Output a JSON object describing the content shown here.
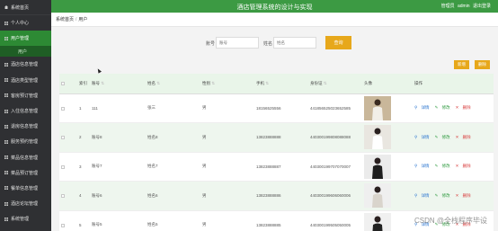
{
  "header": {
    "title": "酒店管理系统的设计与实现",
    "user_prefix": "管理员",
    "username": "admin",
    "logout": "退出登录"
  },
  "sidebar": {
    "home": "系统首页",
    "items": [
      {
        "label": "个人中心"
      },
      {
        "label": "用户管理",
        "active": true
      },
      {
        "label": "酒店信息管理"
      },
      {
        "label": "酒店类型管理"
      },
      {
        "label": "客房预订管理"
      },
      {
        "label": "入住信息管理"
      },
      {
        "label": "退房信息管理"
      },
      {
        "label": "服务预约管理"
      },
      {
        "label": "菜品信息管理"
      },
      {
        "label": "菜品预订管理"
      },
      {
        "label": "餐单信息管理"
      },
      {
        "label": "酒店论坛管理"
      },
      {
        "label": "系统管理"
      }
    ],
    "sub_item": "用户"
  },
  "breadcrumb": [
    "系统首页",
    "用户"
  ],
  "search": {
    "account_label": "账号",
    "account_placeholder": "账号",
    "name_label": "姓名",
    "name_placeholder": "姓名",
    "button": "查询"
  },
  "actions": {
    "add": "新增",
    "delete": "删除"
  },
  "table": {
    "columns": [
      "索引",
      "账号",
      "姓名",
      "性别",
      "手机",
      "身份证",
      "头像",
      "操作"
    ],
    "rows": [
      {
        "index": "1",
        "account": "111",
        "name": "张三",
        "gender": "男",
        "phone": "18156525556",
        "id_card": "441856525023652585"
      },
      {
        "index": "2",
        "account": "账号8",
        "name": "姓名8",
        "gender": "男",
        "phone": "13823888888",
        "id_card": "440300199808088088"
      },
      {
        "index": "3",
        "account": "账号7",
        "name": "姓名7",
        "gender": "男",
        "phone": "13823888887",
        "id_card": "440300199707070007"
      },
      {
        "index": "4",
        "account": "账号6",
        "name": "姓名6",
        "gender": "男",
        "phone": "13823888886",
        "id_card": "440300199606060006"
      },
      {
        "index": "5",
        "account": "账号5",
        "name": "姓名5",
        "gender": "男",
        "phone": "13823888885",
        "id_card": "440300199505050005"
      }
    ],
    "ops": {
      "detail": "详情",
      "edit": "修改",
      "delete": "删除"
    }
  },
  "watermark": "CSDN @全栈程序毕设",
  "colors": {
    "sidebar": "#2f3033",
    "header": "#3c9a43",
    "accent": "#e7a81b",
    "active": "#2d8a34"
  }
}
